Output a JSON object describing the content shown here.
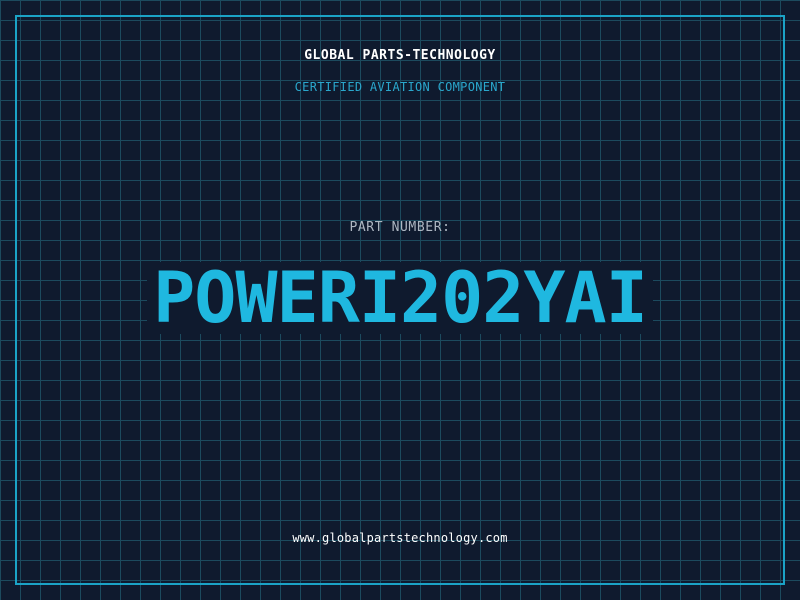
{
  "header": {
    "company": "GLOBAL PARTS-TECHNOLOGY",
    "subtitle": "CERTIFIED AVIATION COMPONENT"
  },
  "part": {
    "label": "PART NUMBER:",
    "number": "POWERI202YAI"
  },
  "footer": {
    "website": "www.globalpartstechnology.com"
  },
  "colors": {
    "background": "#0f1a2e",
    "grid": "#1c4a5e",
    "accent": "#1fb8e0",
    "frame": "#1ba3c6"
  }
}
